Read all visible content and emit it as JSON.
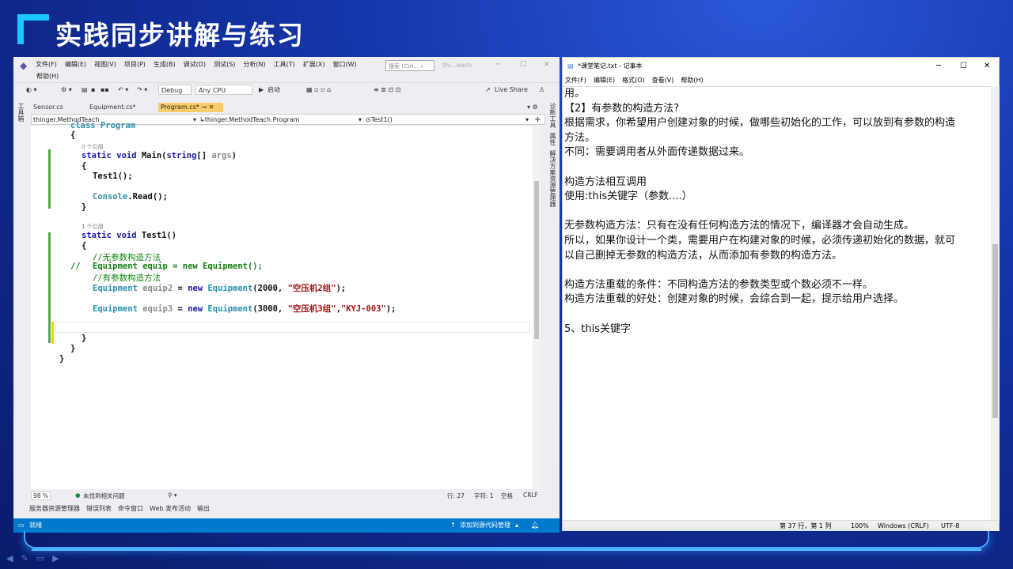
{
  "slide": {
    "title": "实践同步讲解与练习"
  },
  "vs": {
    "menu": [
      "文件(F)",
      "编辑(E)",
      "视图(V)",
      "项目(P)",
      "生成(B)",
      "调试(D)",
      "测试(S)",
      "分析(N)",
      "工具(T)",
      "扩展(X)",
      "窗口(W)"
    ],
    "help_menu": "帮助(H)",
    "search_placeholder": "搜索 (Ctrl...",
    "window_title": "thi...each",
    "toolbar": {
      "config": "Debug",
      "platform": "Any CPU",
      "start": "启动",
      "live_share": "Live Share"
    },
    "tabs": [
      "Sensor.cs",
      "Equipment.cs*",
      "Program.cs*"
    ],
    "nav": {
      "project": "thinger.MethodTeach",
      "class": "thinger.MethodTeach.Program",
      "member": "Test1()"
    },
    "side_left": "工具箱",
    "side_right": [
      "诊断工具",
      "属性",
      "解决方案资源管理器"
    ],
    "code": {
      "l0": "class Program",
      "l1": "{",
      "ref0": "0 个引用",
      "main_kw": "static void ",
      "main_name": "Main(",
      "main_type": "string",
      "main_rest": "[] ",
      "main_args": "args",
      "main_close": ")",
      "l3": "{",
      "test_call": "Test1();",
      "console_type": "Console",
      "console_rest": ".Read();",
      "l6": "}",
      "ref1": "1 个引用",
      "test1_kw": "static void ",
      "test1_name": "Test1()",
      "l9": "{",
      "cm1": "//无参数构造方法",
      "cm2_prefix": "//",
      "cm2": "Equipment equip = new Equipment();",
      "cm3": "//有参数构造方法",
      "e2_type": "Equipment ",
      "e2_var": "equip2",
      "e2_eq": " = ",
      "e2_new": "new ",
      "e2_type2": "Equipment",
      "e2_args1": "(2000, ",
      "e2_str": "\"空压机2组\"",
      "e2_end": ");",
      "e3_type": "Equipment ",
      "e3_var": "equip3",
      "e3_eq": " = ",
      "e3_new": "new ",
      "e3_type2": "Equipment",
      "e3_args1": "(3000, ",
      "e3_str": "\"空压机3组\"",
      "e3_sep": ",",
      "e3_str2": "\"KYJ-003\"",
      "e3_end": ");",
      "close1": "}",
      "close2": "}",
      "close3": "}"
    },
    "status_edit": {
      "zoom": "98 %",
      "issues": "未找到相关问题",
      "line": "行: 27",
      "col": "字符: 1",
      "space": "空格",
      "eol": "CRLF"
    },
    "bottom_tabs": [
      "服务器资源管理器",
      "错误列表",
      "命令窗口",
      "Web 发布活动",
      "输出"
    ],
    "status": {
      "ready": "就绪",
      "source_control": "添加到源代码管理"
    }
  },
  "notepad": {
    "title": "*课堂笔记.txt - 记事本",
    "menu": [
      "文件(F)",
      "编辑(E)",
      "格式(O)",
      "查看(V)",
      "帮助(H)"
    ],
    "lines": [
      "用。",
      "【2】有参数的构造方法?",
      "根据需求，你希望用户创建对象的时候，做哪些初始化的工作，可以放到有参数的构造",
      "方法。",
      "不同：需要调用者从外面传递数据过来。",
      "",
      "构造方法相互调用",
      "使用:this关键字（参数....）",
      "",
      "无参数构造方法：只有在没有任何构造方法的情况下，编译器才会自动生成。",
      "所以，如果你设计一个类，需要用户在构建对象的时候，必须传递初始化的数据，就可",
      "以自己删掉无参数的构造方法，从而添加有参数的构造方法。",
      "",
      "构造方法重载的条件：不同构造方法的参数类型或个数必须不一样。",
      "构造方法重载的好处：创建对象的时候，会综合到一起，提示给用户选择。",
      "",
      "5、this关键字"
    ],
    "status": {
      "pos": "第 37 行，第 1 列",
      "zoom": "100%",
      "eol": "Windows (CRLF)",
      "enc": "UTF-8"
    }
  }
}
